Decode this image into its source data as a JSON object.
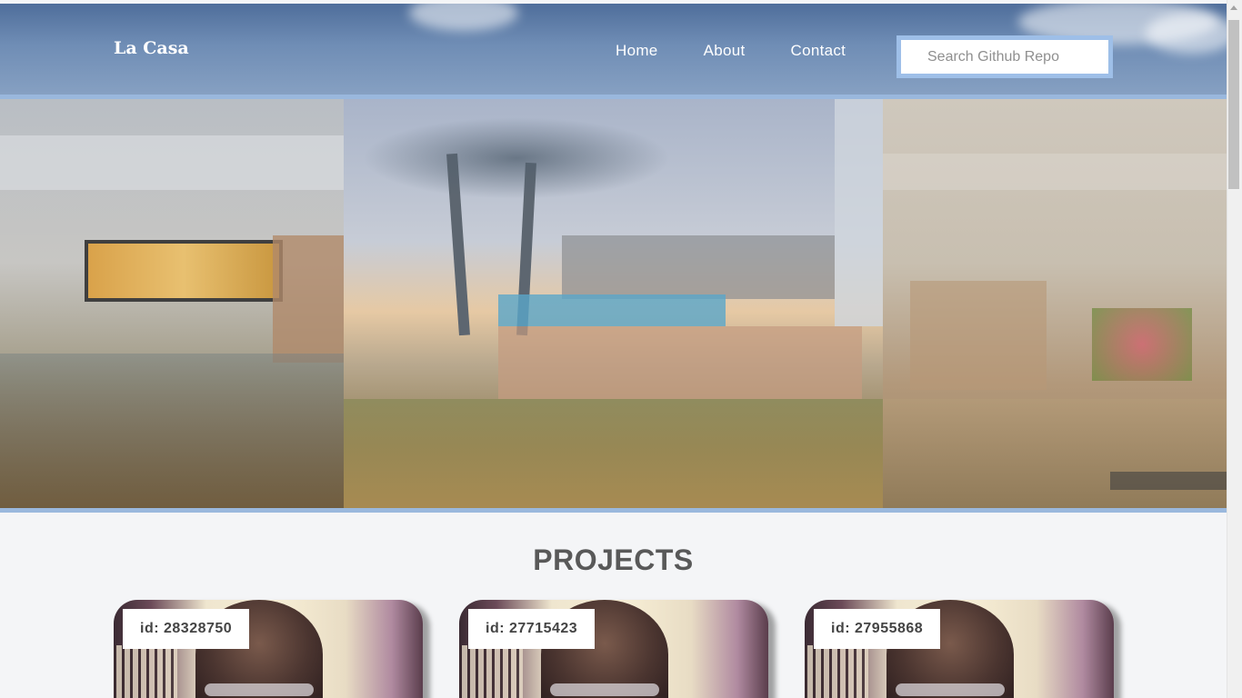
{
  "header": {
    "brand": "La Casa",
    "nav": [
      "Home",
      "About",
      "Contact"
    ],
    "search_placeholder": "Search Github Repo"
  },
  "projects": {
    "title": "PROJECTS",
    "cards": [
      {
        "id_label": "id: 28328750"
      },
      {
        "id_label": "id: 27715423"
      },
      {
        "id_label": "id: 27955868"
      }
    ]
  },
  "colors": {
    "header_blue": "#6f8db5",
    "accent_border": "#9ab8dd",
    "title_gray": "#595959"
  }
}
